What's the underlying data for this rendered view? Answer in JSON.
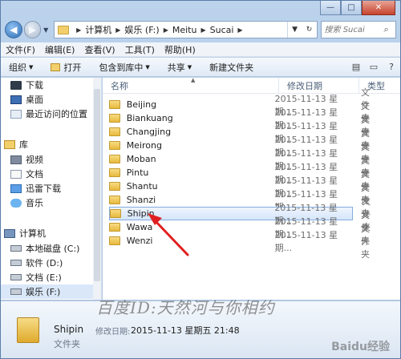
{
  "address": {
    "crumbs": [
      "计算机",
      "娱乐 (F:)",
      "Meitu",
      "Sucai"
    ],
    "search_placeholder": "搜索 Sucai"
  },
  "menubar": [
    "文件(F)",
    "编辑(E)",
    "查看(V)",
    "工具(T)",
    "帮助(H)"
  ],
  "toolbar": {
    "organize": "组织",
    "open": "打开",
    "include": "包含到库中",
    "share": "共享",
    "new_folder": "新建文件夹"
  },
  "nav": {
    "downloads": "下载",
    "desktop": "桌面",
    "recent": "最近访问的位置",
    "libraries": "库",
    "videos": "视频",
    "documents": "文档",
    "xunlei": "迅雷下载",
    "music": "音乐",
    "computer": "计算机",
    "disk_c": "本地磁盘 (C:)",
    "disk_d": "软件 (D:)",
    "disk_e": "文档 (E:)",
    "disk_f": "娱乐 (F:)"
  },
  "columns": {
    "name": "名称",
    "date": "修改日期",
    "type": "类型"
  },
  "files": [
    {
      "name": "Beijing",
      "date": "2015-11-13 星期...",
      "type": "文件夹"
    },
    {
      "name": "Biankuang",
      "date": "2015-11-13 星期...",
      "type": "文件夹"
    },
    {
      "name": "Changjing",
      "date": "2015-11-13 星期...",
      "type": "文件夹"
    },
    {
      "name": "Meirong",
      "date": "2015-11-13 星期...",
      "type": "文件夹"
    },
    {
      "name": "Moban",
      "date": "2015-11-13 星期...",
      "type": "文件夹"
    },
    {
      "name": "Pintu",
      "date": "2015-11-13 星期...",
      "type": "文件夹"
    },
    {
      "name": "Shantu",
      "date": "2015-11-13 星期...",
      "type": "文件夹"
    },
    {
      "name": "Shanzi",
      "date": "2015-11-13 星期...",
      "type": "文件夹"
    },
    {
      "name": "Shipin",
      "date": "2015-11-13 星期...",
      "type": "文件夹"
    },
    {
      "name": "Wawa",
      "date": "2015-11-13 星期...",
      "type": "文件夹"
    },
    {
      "name": "Wenzi",
      "date": "2015-11-13 星期...",
      "type": "文件夹"
    }
  ],
  "details": {
    "name": "Shipin",
    "date_label": "修改日期:",
    "date": "2015-11-13 星期五 21:48",
    "type": "文件夹"
  },
  "watermark": "百度ID:天然河与你相约",
  "baidu_mark": "Baidu经验"
}
